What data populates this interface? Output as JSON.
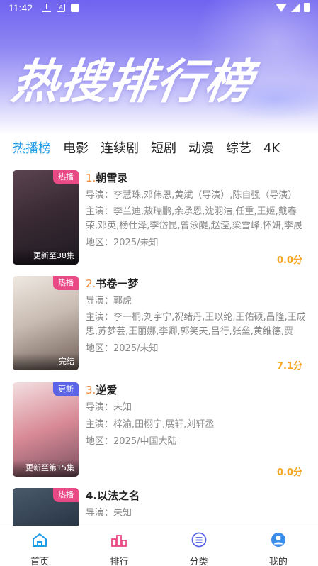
{
  "status": {
    "time": "11:42"
  },
  "hero": {
    "title": "热搜排行榜"
  },
  "tabs": [
    {
      "label": "热播榜",
      "active": true
    },
    {
      "label": "电影",
      "active": false
    },
    {
      "label": "连续剧",
      "active": false
    },
    {
      "label": "短剧",
      "active": false
    },
    {
      "label": "动漫",
      "active": false
    },
    {
      "label": "综艺",
      "active": false
    },
    {
      "label": "4K",
      "active": false
    }
  ],
  "items": [
    {
      "rank": "1.",
      "title": "朝雪录",
      "badge": "热播",
      "badge_type": "hot",
      "episode": "更新至38集",
      "director": "导演：李慧珠,邓伟恩,黄斌（导演）,陈自强（导演）",
      "cast": "主演：李兰迪,敖瑞鹏,余承恩,沈羽洁,任重,王姬,戴春荣,邓英,杨仕泽,李岱昆,曾泳醍,赵滢,梁雪峰,怀妍,李晟",
      "region": "地区：2025/未知",
      "score": "0.0分",
      "poster_colors": [
        "#3a2a33",
        "#6b4a4a",
        "#1e1a22"
      ]
    },
    {
      "rank": "2.",
      "title": "书卷一梦",
      "badge": "热播",
      "badge_type": "hot",
      "episode": "完结",
      "director": "导演：郭虎",
      "cast": "主演：李一桐,刘宇宁,祝绪丹,王以纶,王佑硕,昌隆,王成思,苏梦芸,王丽娜,李卿,郭笑天,吕行,张垒,黄维德,贾",
      "region": "地区：2025/未知",
      "score": "7.1分",
      "poster_colors": [
        "#e9e2da",
        "#b7a9a0",
        "#6e5d56"
      ]
    },
    {
      "rank": "3.",
      "title": "逆爱",
      "badge": "更新",
      "badge_type": "new",
      "episode": "更新至第15集",
      "director": "导演：未知",
      "cast": "主演：梓渝,田栩宁,展轩,刘轩丞",
      "region": "地区：2025/中国大陆",
      "score": "0.0分",
      "poster_colors": [
        "#f0d6d6",
        "#d88a96",
        "#7a5060"
      ]
    },
    {
      "rank": "4.",
      "title": "以法之名",
      "badge": "热播",
      "badge_type": "hot",
      "episode": "",
      "director": "导演：未知",
      "cast": "",
      "region": "",
      "score": "",
      "poster_colors": [
        "#2d3a4a",
        "#4a5a6b",
        "#1a222c"
      ]
    }
  ],
  "nav": [
    {
      "label": "首页",
      "icon": "home-icon"
    },
    {
      "label": "排行",
      "icon": "ranking-icon"
    },
    {
      "label": "分类",
      "icon": "category-icon"
    },
    {
      "label": "我的",
      "icon": "profile-icon"
    }
  ],
  "colors": {
    "accent": "#1f9ce8",
    "rank": "#f28a3a",
    "score": "#f5a623",
    "hot_badge": "#e94a86",
    "new_badge": "#5a64e6"
  }
}
